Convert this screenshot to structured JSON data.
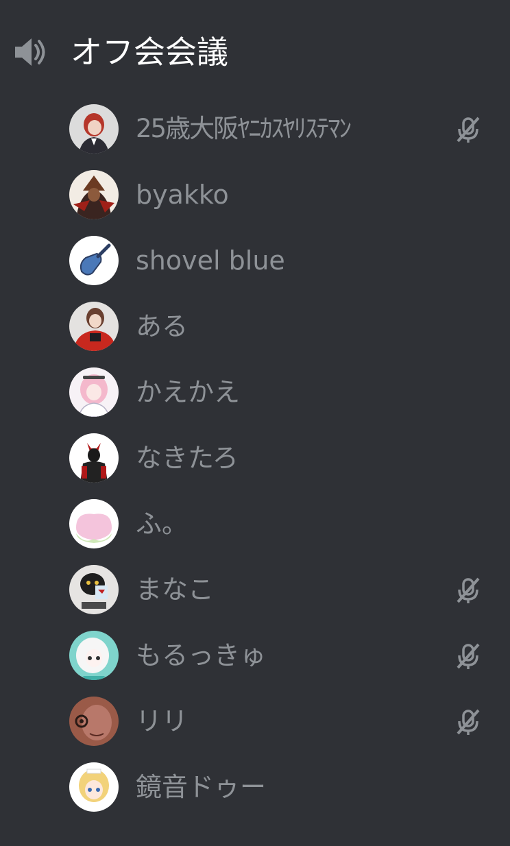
{
  "channel": {
    "name": "オフ会会議",
    "icon": "speaker-icon"
  },
  "members": [
    {
      "name": "25歳大阪ﾔﾆｶｽﾔﾘｽﾃﾏﾝ",
      "muted": true,
      "avatar": "red-hair-suit"
    },
    {
      "name": "byakko",
      "muted": false,
      "avatar": "warrior"
    },
    {
      "name": "shovel blue",
      "muted": false,
      "avatar": "shovel"
    },
    {
      "name": "ある",
      "muted": false,
      "avatar": "red-jacket-girl"
    },
    {
      "name": "かえかえ",
      "muted": false,
      "avatar": "pink-hair-girl"
    },
    {
      "name": "なきたろ",
      "muted": false,
      "avatar": "dark-figure"
    },
    {
      "name": "ふ。",
      "muted": false,
      "avatar": "peach"
    },
    {
      "name": "まなこ",
      "muted": true,
      "avatar": "black-cat-plush"
    },
    {
      "name": "もるっきゅ",
      "muted": true,
      "avatar": "white-hair-girl"
    },
    {
      "name": "リリ",
      "muted": true,
      "avatar": "brown-face"
    },
    {
      "name": "鏡音ドゥー",
      "muted": false,
      "avatar": "blonde-girl"
    }
  ]
}
